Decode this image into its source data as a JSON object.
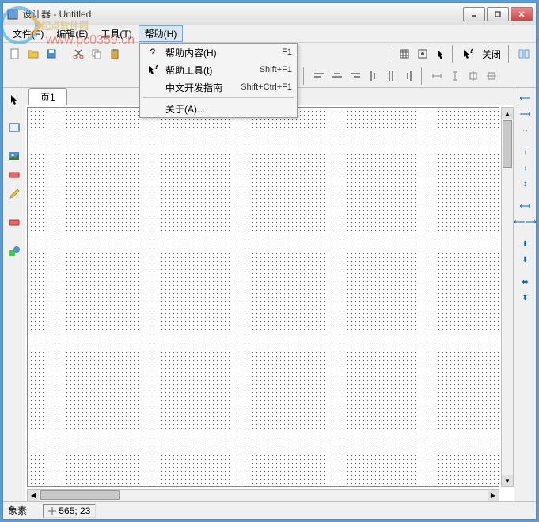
{
  "window": {
    "title": "设计器 - Untitled"
  },
  "menu": {
    "file": "文件(F)",
    "edit": "编辑(E)",
    "tools": "工具(T)",
    "help": "帮助(H)"
  },
  "help_menu": {
    "contents": {
      "label": "帮助内容(H)",
      "shortcut": "F1"
    },
    "tool": {
      "label": "帮助工具(t)",
      "shortcut": "Shift+F1"
    },
    "guide": {
      "label": "中文开发指南",
      "shortcut": "Shift+Ctrl+F1"
    },
    "about": {
      "label": "关于(A)...",
      "shortcut": ""
    }
  },
  "toolbar": {
    "close": "关闭"
  },
  "tabs": {
    "page1": "页1"
  },
  "status": {
    "label": "象素",
    "coords": "565; 23"
  },
  "watermark": {
    "text": "起点软件园",
    "url": "www.pc0359.cn"
  }
}
